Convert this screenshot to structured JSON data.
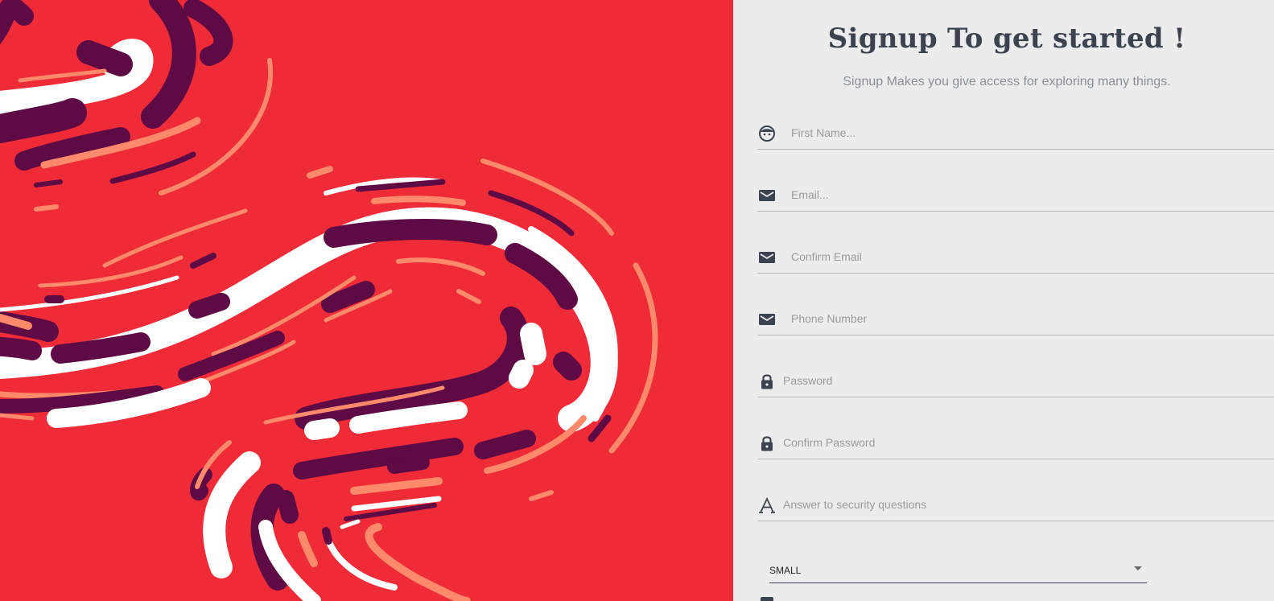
{
  "signup": {
    "title": "Signup To get started !",
    "subtitle": "Signup Makes you give access for exploring many things."
  },
  "fields": [
    {
      "name": "first-name",
      "icon": "face-icon",
      "placeholder": "First Name...",
      "value": ""
    },
    {
      "name": "email",
      "icon": "mail-icon",
      "placeholder": "Email...",
      "value": ""
    },
    {
      "name": "confirm-email",
      "icon": "mail-icon",
      "placeholder": "Confirm Email",
      "value": ""
    },
    {
      "name": "phone-number",
      "icon": "mail-icon",
      "placeholder": "Phone Number",
      "value": ""
    },
    {
      "name": "password",
      "icon": "lock-icon",
      "placeholder": "Password",
      "value": ""
    },
    {
      "name": "confirm-password",
      "icon": "lock-icon",
      "placeholder": "Confirm Password",
      "value": ""
    },
    {
      "name": "security-answer",
      "icon": "text-icon",
      "placeholder": "Answer to security questions",
      "value": ""
    }
  ],
  "size_select": {
    "selected": "SMALL"
  },
  "colors": {
    "art_background": "#ef2b38",
    "art_plum": "#5e0a45",
    "art_salmon": "#ff8a6b",
    "art_white": "#ffffff",
    "title_text": "#3c4350",
    "panel_background": "#ececec"
  }
}
